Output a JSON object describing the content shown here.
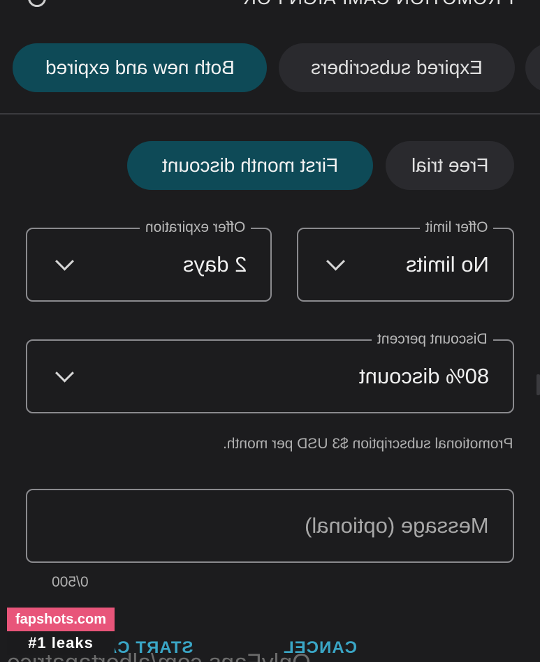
{
  "header": {
    "title": "PROMOTION CAMPAIGN FOR",
    "icon": "info-icon"
  },
  "audience": {
    "options": [
      {
        "label": "Both new and expired",
        "active": true
      },
      {
        "label": "Expired subscribers",
        "active": false
      }
    ]
  },
  "offer_type": {
    "options": [
      {
        "label": "First month discount",
        "active": true
      },
      {
        "label": "Free trial",
        "active": false
      }
    ]
  },
  "fields": {
    "offer_expiration": {
      "legend": "Offer expiration",
      "value": "2 days"
    },
    "offer_limit": {
      "legend": "Offer limit",
      "value": "No limits"
    },
    "discount_percent": {
      "legend": "Discount percent",
      "value": "80% discount"
    }
  },
  "hint": "Promotional subscription $3 USD per month.",
  "message": {
    "placeholder": "Message (optional)",
    "counter": "0/500"
  },
  "actions": {
    "start": "START CAM",
    "cancel": "CANCEL"
  },
  "footer_text": "OnlyFans.com/albertapatrice",
  "watermark": {
    "site": "fapshots.com",
    "tagline": "#1 leaks"
  },
  "colors": {
    "accent": "#0e4a57",
    "link": "#3aa6c6",
    "background": "#1c1c1e"
  }
}
